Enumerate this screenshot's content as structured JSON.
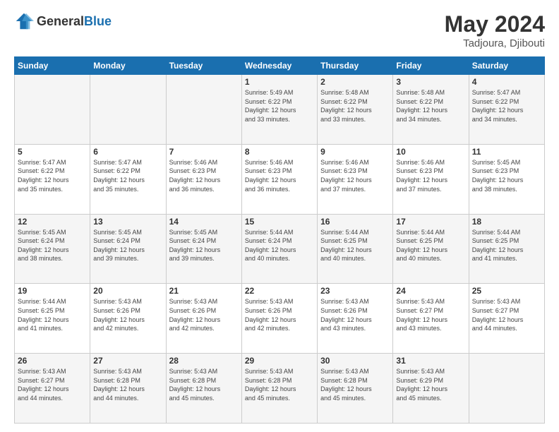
{
  "header": {
    "logo": {
      "general": "General",
      "blue": "Blue"
    },
    "title": "May 2024",
    "location": "Tadjoura, Djibouti"
  },
  "weekdays": [
    "Sunday",
    "Monday",
    "Tuesday",
    "Wednesday",
    "Thursday",
    "Friday",
    "Saturday"
  ],
  "weeks": [
    [
      {
        "day": "",
        "info": ""
      },
      {
        "day": "",
        "info": ""
      },
      {
        "day": "",
        "info": ""
      },
      {
        "day": "1",
        "info": "Sunrise: 5:49 AM\nSunset: 6:22 PM\nDaylight: 12 hours\nand 33 minutes."
      },
      {
        "day": "2",
        "info": "Sunrise: 5:48 AM\nSunset: 6:22 PM\nDaylight: 12 hours\nand 33 minutes."
      },
      {
        "day": "3",
        "info": "Sunrise: 5:48 AM\nSunset: 6:22 PM\nDaylight: 12 hours\nand 34 minutes."
      },
      {
        "day": "4",
        "info": "Sunrise: 5:47 AM\nSunset: 6:22 PM\nDaylight: 12 hours\nand 34 minutes."
      }
    ],
    [
      {
        "day": "5",
        "info": "Sunrise: 5:47 AM\nSunset: 6:22 PM\nDaylight: 12 hours\nand 35 minutes."
      },
      {
        "day": "6",
        "info": "Sunrise: 5:47 AM\nSunset: 6:22 PM\nDaylight: 12 hours\nand 35 minutes."
      },
      {
        "day": "7",
        "info": "Sunrise: 5:46 AM\nSunset: 6:23 PM\nDaylight: 12 hours\nand 36 minutes."
      },
      {
        "day": "8",
        "info": "Sunrise: 5:46 AM\nSunset: 6:23 PM\nDaylight: 12 hours\nand 36 minutes."
      },
      {
        "day": "9",
        "info": "Sunrise: 5:46 AM\nSunset: 6:23 PM\nDaylight: 12 hours\nand 37 minutes."
      },
      {
        "day": "10",
        "info": "Sunrise: 5:46 AM\nSunset: 6:23 PM\nDaylight: 12 hours\nand 37 minutes."
      },
      {
        "day": "11",
        "info": "Sunrise: 5:45 AM\nSunset: 6:23 PM\nDaylight: 12 hours\nand 38 minutes."
      }
    ],
    [
      {
        "day": "12",
        "info": "Sunrise: 5:45 AM\nSunset: 6:24 PM\nDaylight: 12 hours\nand 38 minutes."
      },
      {
        "day": "13",
        "info": "Sunrise: 5:45 AM\nSunset: 6:24 PM\nDaylight: 12 hours\nand 39 minutes."
      },
      {
        "day": "14",
        "info": "Sunrise: 5:45 AM\nSunset: 6:24 PM\nDaylight: 12 hours\nand 39 minutes."
      },
      {
        "day": "15",
        "info": "Sunrise: 5:44 AM\nSunset: 6:24 PM\nDaylight: 12 hours\nand 40 minutes."
      },
      {
        "day": "16",
        "info": "Sunrise: 5:44 AM\nSunset: 6:25 PM\nDaylight: 12 hours\nand 40 minutes."
      },
      {
        "day": "17",
        "info": "Sunrise: 5:44 AM\nSunset: 6:25 PM\nDaylight: 12 hours\nand 40 minutes."
      },
      {
        "day": "18",
        "info": "Sunrise: 5:44 AM\nSunset: 6:25 PM\nDaylight: 12 hours\nand 41 minutes."
      }
    ],
    [
      {
        "day": "19",
        "info": "Sunrise: 5:44 AM\nSunset: 6:25 PM\nDaylight: 12 hours\nand 41 minutes."
      },
      {
        "day": "20",
        "info": "Sunrise: 5:43 AM\nSunset: 6:26 PM\nDaylight: 12 hours\nand 42 minutes."
      },
      {
        "day": "21",
        "info": "Sunrise: 5:43 AM\nSunset: 6:26 PM\nDaylight: 12 hours\nand 42 minutes."
      },
      {
        "day": "22",
        "info": "Sunrise: 5:43 AM\nSunset: 6:26 PM\nDaylight: 12 hours\nand 42 minutes."
      },
      {
        "day": "23",
        "info": "Sunrise: 5:43 AM\nSunset: 6:26 PM\nDaylight: 12 hours\nand 43 minutes."
      },
      {
        "day": "24",
        "info": "Sunrise: 5:43 AM\nSunset: 6:27 PM\nDaylight: 12 hours\nand 43 minutes."
      },
      {
        "day": "25",
        "info": "Sunrise: 5:43 AM\nSunset: 6:27 PM\nDaylight: 12 hours\nand 44 minutes."
      }
    ],
    [
      {
        "day": "26",
        "info": "Sunrise: 5:43 AM\nSunset: 6:27 PM\nDaylight: 12 hours\nand 44 minutes."
      },
      {
        "day": "27",
        "info": "Sunrise: 5:43 AM\nSunset: 6:28 PM\nDaylight: 12 hours\nand 44 minutes."
      },
      {
        "day": "28",
        "info": "Sunrise: 5:43 AM\nSunset: 6:28 PM\nDaylight: 12 hours\nand 45 minutes."
      },
      {
        "day": "29",
        "info": "Sunrise: 5:43 AM\nSunset: 6:28 PM\nDaylight: 12 hours\nand 45 minutes."
      },
      {
        "day": "30",
        "info": "Sunrise: 5:43 AM\nSunset: 6:28 PM\nDaylight: 12 hours\nand 45 minutes."
      },
      {
        "day": "31",
        "info": "Sunrise: 5:43 AM\nSunset: 6:29 PM\nDaylight: 12 hours\nand 45 minutes."
      },
      {
        "day": "",
        "info": ""
      }
    ]
  ]
}
